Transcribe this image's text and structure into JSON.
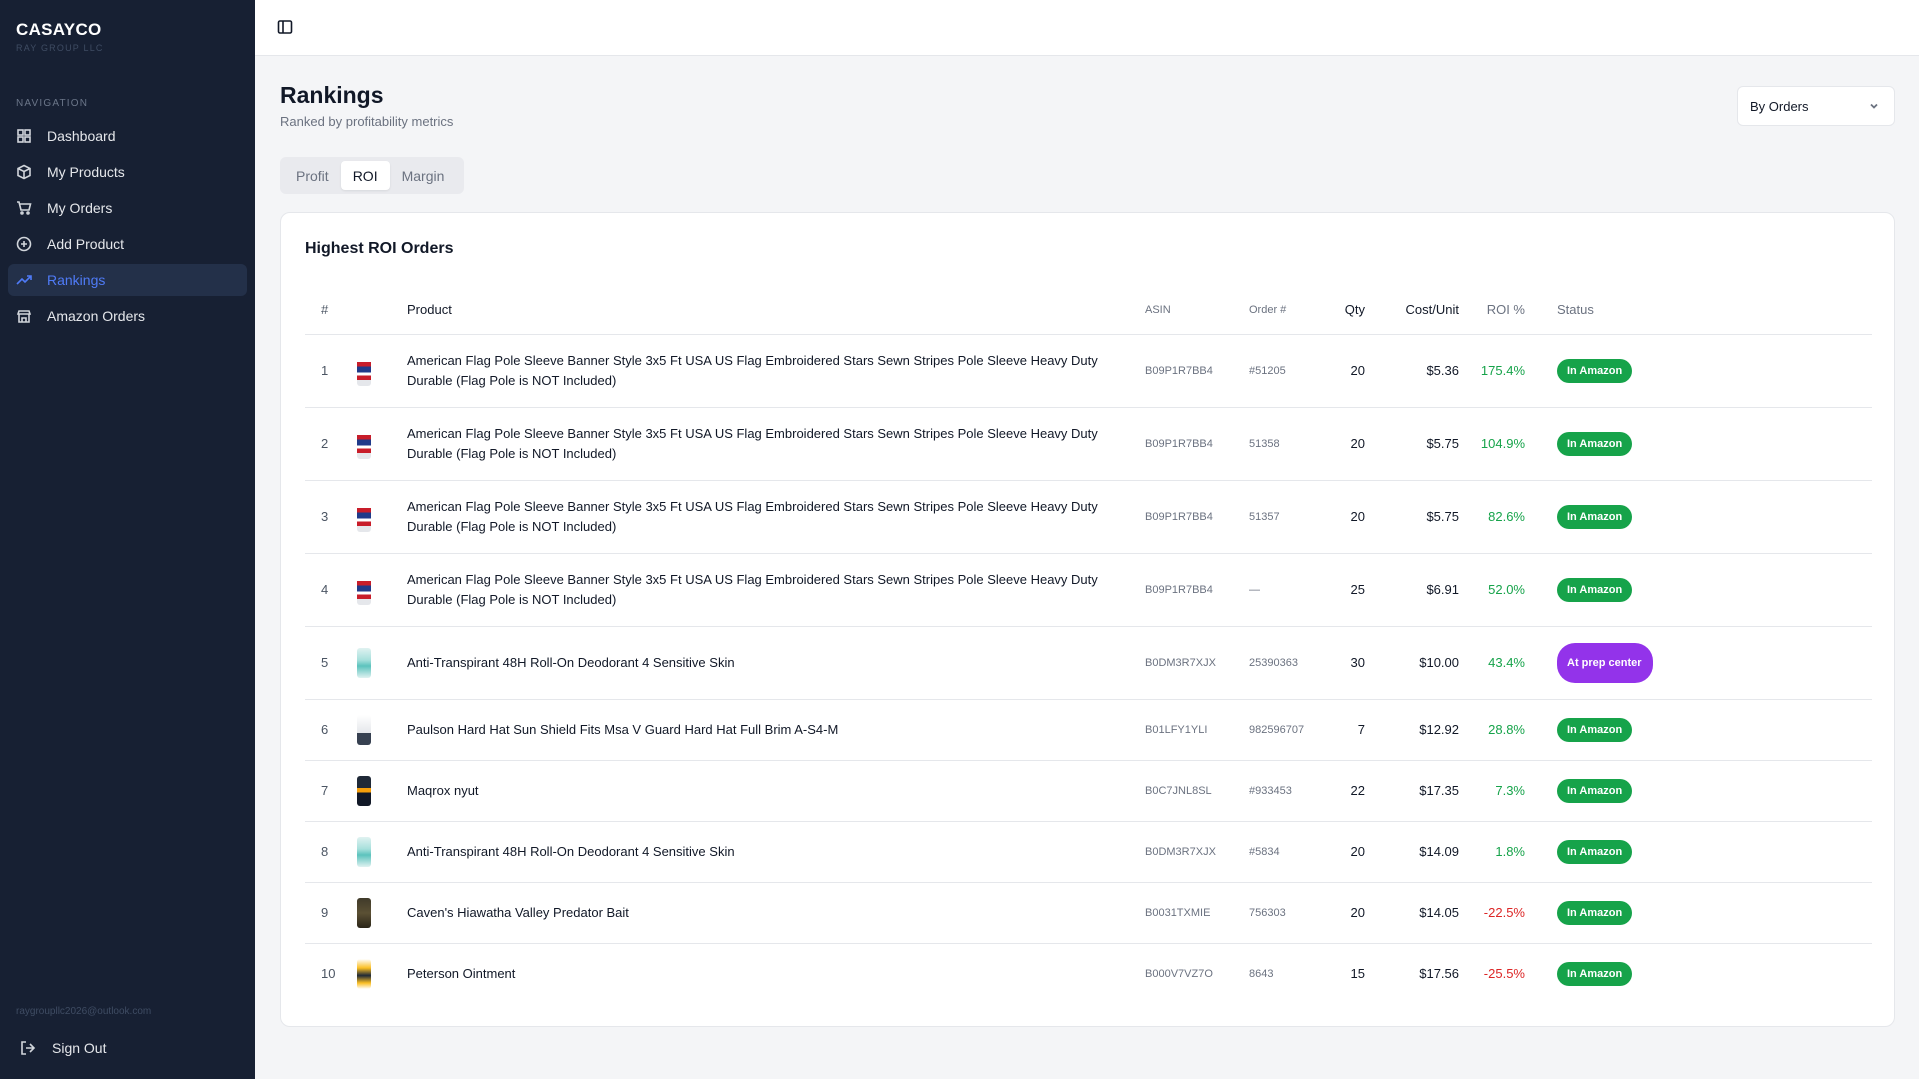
{
  "brand": {
    "name": "CASAYCO",
    "subtitle": "RAY GROUP LLC"
  },
  "sidebar": {
    "heading": "NAVIGATION",
    "items": [
      {
        "label": "Dashboard",
        "icon": "grid-icon"
      },
      {
        "label": "My Products",
        "icon": "box-icon"
      },
      {
        "label": "My Orders",
        "icon": "cart-icon"
      },
      {
        "label": "Add Product",
        "icon": "plus-circle-icon"
      },
      {
        "label": "Rankings",
        "icon": "trending-up-icon",
        "active": true
      },
      {
        "label": "Amazon Orders",
        "icon": "store-icon"
      }
    ],
    "user_email": "raygroupllc2026@outlook.com",
    "signout_label": "Sign Out"
  },
  "header": {
    "title": "Rankings",
    "subtitle": "Ranked by profitability metrics",
    "sort_select": {
      "value": "By Orders"
    }
  },
  "tabs": [
    {
      "label": "Profit"
    },
    {
      "label": "ROI",
      "active": true
    },
    {
      "label": "Margin"
    }
  ],
  "card": {
    "title": "Highest ROI Orders",
    "columns": [
      "#",
      "Product",
      "ASIN",
      "Order #",
      "Qty",
      "Cost/Unit",
      "ROI %",
      "Status"
    ],
    "rows": [
      {
        "rank": "1",
        "thumb": "flag",
        "product": "American Flag Pole Sleeve Banner Style 3x5 Ft USA US Flag Embroidered Stars Sewn Stripes Pole Sleeve Heavy Duty Durable (Flag Pole is NOT Included)",
        "asin": "B09P1R7BB4",
        "order": "#51205",
        "qty": "20",
        "cost": "$5.36",
        "roi": "175.4%",
        "roi_sign": "pos",
        "status": "In Amazon",
        "status_color": "green"
      },
      {
        "rank": "2",
        "thumb": "flag",
        "product": "American Flag Pole Sleeve Banner Style 3x5 Ft USA US Flag Embroidered Stars Sewn Stripes Pole Sleeve Heavy Duty Durable (Flag Pole is NOT Included)",
        "asin": "B09P1R7BB4",
        "order": "51358",
        "qty": "20",
        "cost": "$5.75",
        "roi": "104.9%",
        "roi_sign": "pos",
        "status": "In Amazon",
        "status_color": "green"
      },
      {
        "rank": "3",
        "thumb": "flag",
        "product": "American Flag Pole Sleeve Banner Style 3x5 Ft USA US Flag Embroidered Stars Sewn Stripes Pole Sleeve Heavy Duty Durable (Flag Pole is NOT Included)",
        "asin": "B09P1R7BB4",
        "order": "51357",
        "qty": "20",
        "cost": "$5.75",
        "roi": "82.6%",
        "roi_sign": "pos",
        "status": "In Amazon",
        "status_color": "green"
      },
      {
        "rank": "4",
        "thumb": "flag",
        "product": "American Flag Pole Sleeve Banner Style 3x5 Ft USA US Flag Embroidered Stars Sewn Stripes Pole Sleeve Heavy Duty Durable (Flag Pole is NOT Included)",
        "asin": "B09P1R7BB4",
        "order": "—",
        "qty": "25",
        "cost": "$6.91",
        "roi": "52.0%",
        "roi_sign": "pos",
        "status": "In Amazon",
        "status_color": "green"
      },
      {
        "rank": "5",
        "thumb": "deo",
        "product": "Anti-Transpirant 48H Roll-On Deodorant 4 Sensitive Skin",
        "asin": "B0DM3R7XJX",
        "order": "25390363",
        "qty": "30",
        "cost": "$10.00",
        "roi": "43.4%",
        "roi_sign": "pos",
        "status": "At prep center",
        "status_color": "purple"
      },
      {
        "rank": "6",
        "thumb": "hat",
        "product": "Paulson Hard Hat Sun Shield Fits Msa V Guard Hard Hat Full Brim A-S4-M",
        "asin": "B01LFY1YLI",
        "order": "982596707",
        "qty": "7",
        "cost": "$12.92",
        "roi": "28.8%",
        "roi_sign": "pos",
        "status": "In Amazon",
        "status_color": "green"
      },
      {
        "rank": "7",
        "thumb": "maq",
        "product": "Maqrox nyut",
        "asin": "B0C7JNL8SL",
        "order": "#933453",
        "qty": "22",
        "cost": "$17.35",
        "roi": "7.3%",
        "roi_sign": "pos",
        "status": "In Amazon",
        "status_color": "green"
      },
      {
        "rank": "8",
        "thumb": "deo",
        "product": "Anti-Transpirant 48H Roll-On Deodorant 4 Sensitive Skin",
        "asin": "B0DM3R7XJX",
        "order": "#5834",
        "qty": "20",
        "cost": "$14.09",
        "roi": "1.8%",
        "roi_sign": "pos",
        "status": "In Amazon",
        "status_color": "green"
      },
      {
        "rank": "9",
        "thumb": "bait",
        "product": "Caven's Hiawatha Valley Predator Bait",
        "asin": "B0031TXMIE",
        "order": "756303",
        "qty": "20",
        "cost": "$14.05",
        "roi": "-22.5%",
        "roi_sign": "neg",
        "status": "In Amazon",
        "status_color": "green"
      },
      {
        "rank": "10",
        "thumb": "oint",
        "product": "Peterson Ointment",
        "asin": "B000V7VZ7O",
        "order": "8643",
        "qty": "15",
        "cost": "$17.56",
        "roi": "-25.5%",
        "roi_sign": "neg",
        "status": "In Amazon",
        "status_color": "green"
      }
    ]
  },
  "colors": {
    "sidebar_bg": "#172033",
    "accent": "#4f7bf7",
    "positive": "#16a34a",
    "negative": "#dc2626",
    "status_green": "#16a34a",
    "status_purple": "#9333ea"
  }
}
